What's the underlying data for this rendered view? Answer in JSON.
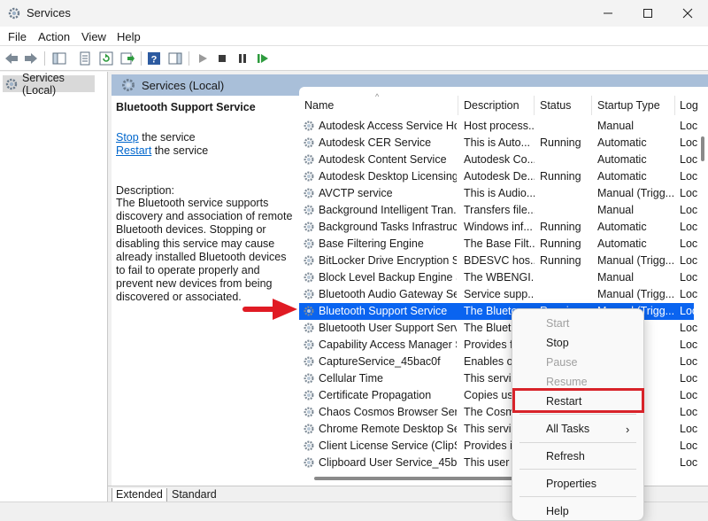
{
  "window": {
    "title": "Services",
    "minimize_icon": "minimize-icon",
    "maximize_icon": "maximize-icon",
    "close_icon": "close-icon"
  },
  "menu": [
    "File",
    "Action",
    "View",
    "Help"
  ],
  "tree": {
    "item": "Services (Local)"
  },
  "panel": {
    "header": "Services (Local)"
  },
  "details": {
    "title": "Bluetooth Support Service",
    "stop_link": "Stop",
    "stop_rest": " the service",
    "restart_link": "Restart",
    "restart_rest": " the service",
    "description_label": "Description:",
    "description": "The Bluetooth service supports discovery and association of remote Bluetooth devices.  Stopping or disabling this service may cause already installed Bluetooth devices to fail to operate properly and prevent new devices from being discovered or associated."
  },
  "columns": {
    "name": "Name",
    "description": "Description",
    "status": "Status",
    "startup": "Startup Type",
    "logon": "Log"
  },
  "rows": [
    {
      "name": "Autodesk Access Service Host",
      "desc": "Host process...",
      "status": "",
      "startup": "Manual",
      "logon": "Loc"
    },
    {
      "name": "Autodesk CER Service",
      "desc": "This is Auto...",
      "status": "Running",
      "startup": "Automatic",
      "logon": "Loc"
    },
    {
      "name": "Autodesk Content Service",
      "desc": "Autodesk Co...",
      "status": "",
      "startup": "Automatic",
      "logon": "Loc"
    },
    {
      "name": "Autodesk Desktop Licensing...",
      "desc": "Autodesk De...",
      "status": "Running",
      "startup": "Automatic",
      "logon": "Loc"
    },
    {
      "name": "AVCTP service",
      "desc": "This is Audio...",
      "status": "",
      "startup": "Manual (Trigg...",
      "logon": "Loc"
    },
    {
      "name": "Background Intelligent Tran...",
      "desc": "Transfers file...",
      "status": "",
      "startup": "Manual",
      "logon": "Loc"
    },
    {
      "name": "Background Tasks Infrastruc...",
      "desc": "Windows inf...",
      "status": "Running",
      "startup": "Automatic",
      "logon": "Loc"
    },
    {
      "name": "Base Filtering Engine",
      "desc": "The Base Filt...",
      "status": "Running",
      "startup": "Automatic",
      "logon": "Loc"
    },
    {
      "name": "BitLocker Drive Encryption S...",
      "desc": "BDESVC hos...",
      "status": "Running",
      "startup": "Manual (Trigg...",
      "logon": "Loc"
    },
    {
      "name": "Block Level Backup Engine S...",
      "desc": "The WBENGI...",
      "status": "",
      "startup": "Manual",
      "logon": "Loc"
    },
    {
      "name": "Bluetooth Audio Gateway Se...",
      "desc": "Service supp...",
      "status": "",
      "startup": "Manual (Trigg...",
      "logon": "Loc"
    },
    {
      "name": "Bluetooth Support Service",
      "desc": "The Blueto",
      "status": "Running",
      "startup": "Manual (Trigg...",
      "logon": "Loc"
    },
    {
      "name": "Bluetooth User Support Serv...",
      "desc": "The Blueto",
      "status": "",
      "startup": "",
      "logon": "Loc"
    },
    {
      "name": "Capability Access Manager S...",
      "desc": "Provides fa",
      "status": "",
      "startup": "",
      "logon": "Loc"
    },
    {
      "name": "CaptureService_45bac0f",
      "desc": "Enables op",
      "status": "",
      "startup": "",
      "logon": "Loc"
    },
    {
      "name": "Cellular Time",
      "desc": "This servic",
      "status": "",
      "startup": "",
      "logon": "Loc"
    },
    {
      "name": "Certificate Propagation",
      "desc": "Copies use",
      "status": "",
      "startup": "",
      "logon": "Loc"
    },
    {
      "name": "Chaos Cosmos Browser Servi...",
      "desc": "The Cosmo",
      "status": "",
      "startup": "",
      "logon": "Loc"
    },
    {
      "name": "Chrome Remote Desktop Se...",
      "desc": "This servic",
      "status": "",
      "startup": "",
      "logon": "Loc"
    },
    {
      "name": "Client License Service (ClipSV...",
      "desc": "Provides in",
      "status": "",
      "startup": "",
      "logon": "Loc"
    },
    {
      "name": "Clipboard User Service_45ba...",
      "desc": "This user s",
      "status": "",
      "startup": "",
      "logon": "Loc"
    }
  ],
  "context_menu": {
    "start": "Start",
    "stop": "Stop",
    "pause": "Pause",
    "resume": "Resume",
    "restart": "Restart",
    "all_tasks": "All Tasks",
    "refresh": "Refresh",
    "properties": "Properties",
    "help": "Help"
  },
  "tabs": [
    "Extended",
    "Standard"
  ],
  "colors": {
    "selection": "#0a64f0",
    "header_blue": "#a9bfd9",
    "highlight_red": "#d8232a",
    "link": "#0066cc"
  }
}
